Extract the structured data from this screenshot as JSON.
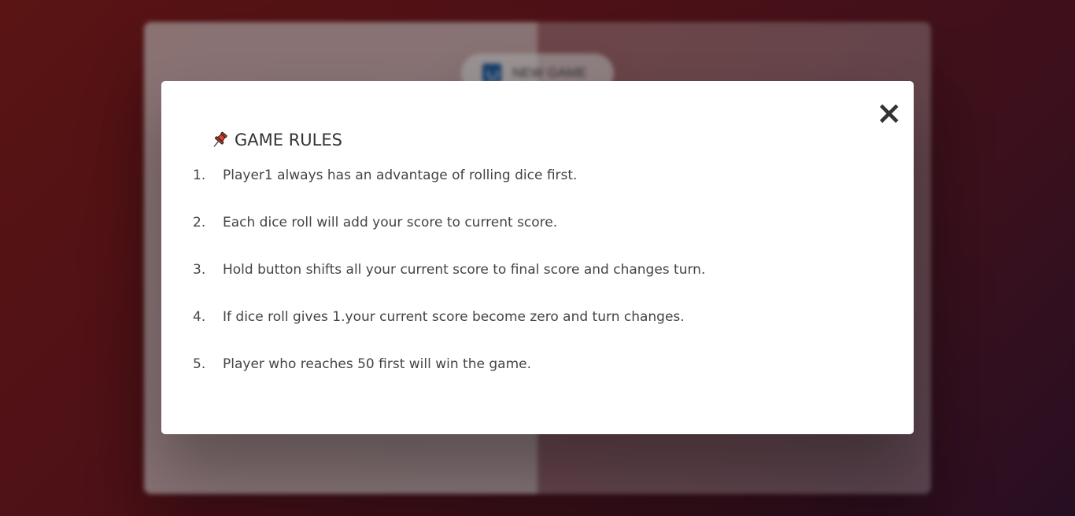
{
  "game": {
    "new_game_label": "New game"
  },
  "modal": {
    "close_label": "×",
    "title": "GAME RULES",
    "title_icon": "pushpin-icon",
    "rules": [
      {
        "num": "1.",
        "text": "Player1 always has an advantage of rolling dice first."
      },
      {
        "num": "2.",
        "text": "Each dice roll will add your score to current score."
      },
      {
        "num": "3.",
        "text": "Hold button shifts all your current score to final score and changes turn."
      },
      {
        "num": "4.",
        "text": "If dice roll gives 1.your current score become zero and turn changes."
      },
      {
        "num": "5.",
        "text": "Player who reaches 50 first will win the game."
      }
    ]
  },
  "colors": {
    "accent": "#e0412a",
    "background_start": "#8a1f1f",
    "background_end": "#3d1636"
  }
}
